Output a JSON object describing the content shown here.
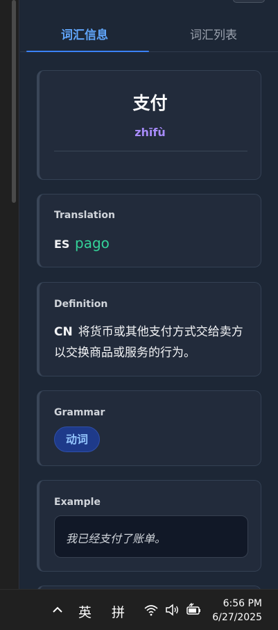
{
  "tabs": [
    {
      "label": "词汇信息",
      "active": true
    },
    {
      "label": "词汇列表",
      "active": false
    }
  ],
  "word": {
    "hanzi": "支付",
    "pinyin": "zhīfù"
  },
  "translation": {
    "label": "Translation",
    "lang": "ES",
    "value": "pago"
  },
  "definition": {
    "label": "Definition",
    "lang": "CN",
    "text": "将货币或其他支付方式交给卖方以交换商品或服务的行为。"
  },
  "grammar": {
    "label": "Grammar",
    "pos": "动词"
  },
  "example": {
    "label": "Example",
    "text": "我已经支付了账单。"
  },
  "taskbar": {
    "ime_mode_1": "英",
    "ime_mode_2": "拼",
    "time": "6:56 PM",
    "date": "6/27/2025",
    "icons": [
      "chevron-up-icon",
      "wifi-icon",
      "volume-icon",
      "battery-icon"
    ]
  },
  "colors": {
    "accent": "#60a5fa",
    "pinyin": "#a78bfa",
    "translation": "#34d399",
    "pill_bg": "#1e3a8a"
  }
}
